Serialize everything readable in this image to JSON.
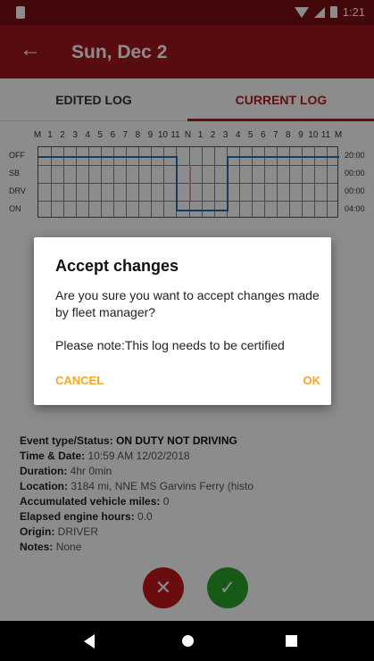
{
  "status_bar": {
    "time": "1:21"
  },
  "app_bar": {
    "back_icon": "arrow-left-icon",
    "title": "Sun, Dec 2"
  },
  "tabs": [
    {
      "label": "EDITED LOG"
    },
    {
      "label": "CURRENT LOG"
    }
  ],
  "log_grid": {
    "hour_labels": [
      "M",
      "1",
      "2",
      "3",
      "4",
      "5",
      "6",
      "7",
      "8",
      "9",
      "10",
      "11",
      "N",
      "1",
      "2",
      "3",
      "4",
      "5",
      "6",
      "7",
      "8",
      "9",
      "10",
      "11",
      "M"
    ],
    "row_labels": [
      "OFF",
      "SB",
      "DRV",
      "ON"
    ],
    "row_totals": [
      "20:00",
      "00:00",
      "00:00",
      "04:00"
    ],
    "line_color": "#1f6fb2",
    "edit_marker_color": "#e8a0a0"
  },
  "event": {
    "status_label": "Event type/Status:",
    "status_value": "ON DUTY NOT DRIVING",
    "time_label": "Time & Date:",
    "time_value": "10:59 AM 12/02/2018",
    "duration_label": "Duration:",
    "duration_value": "4hr 0min",
    "location_label": "Location:",
    "location_value": "3184 mi, NNE MS Garvins Ferry (histo",
    "miles_label": "Accumulated vehicle miles:",
    "miles_value": "0",
    "hours_label": "Elapsed engine hours:",
    "hours_value": "0.0",
    "origin_label": "Origin:",
    "origin_value": "DRIVER",
    "notes_label": "Notes:",
    "notes_value": "None"
  },
  "dialog": {
    "title": "Accept changes",
    "body": "Are you sure you want to accept changes made by fleet manager?",
    "note": "Please note:This log needs to be certified",
    "cancel": "CANCEL",
    "ok": "OK",
    "accent": "#f5a623"
  },
  "fabs": {
    "reject_icon": "close-icon",
    "accept_icon": "check-icon"
  },
  "colors": {
    "status_bar": "#7a0f13",
    "app_bar": "#a1171c",
    "accent": "#b81b20"
  }
}
